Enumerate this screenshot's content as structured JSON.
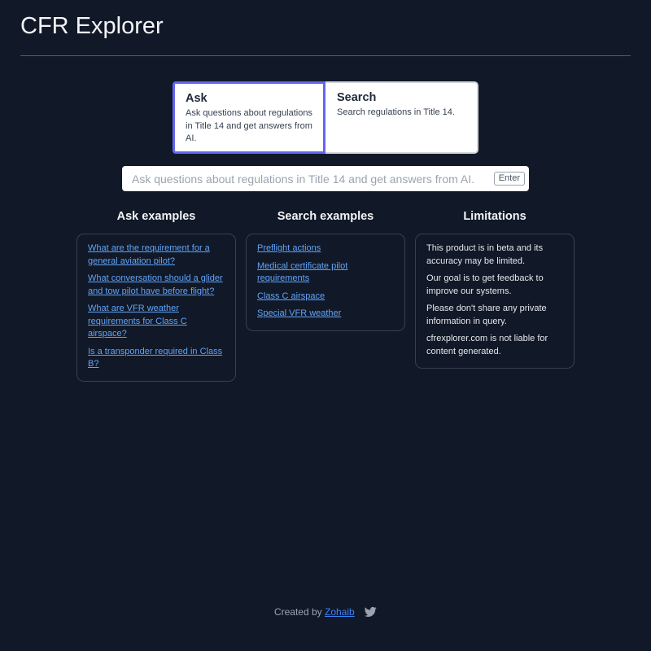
{
  "header": {
    "title": "CFR Explorer"
  },
  "modes": [
    {
      "title": "Ask",
      "description": "Ask questions about regulations in Title 14 and get answers from AI.",
      "active": true
    },
    {
      "title": "Search",
      "description": "Search regulations in Title 14.",
      "active": false
    }
  ],
  "query": {
    "value": "",
    "placeholder": "Ask questions about regulations in Title 14 and get answers from AI.",
    "enter_label": "Enter"
  },
  "ask_examples": {
    "title": "Ask examples",
    "items": [
      "What are the requirement for a general aviation pilot?",
      "What conversation should a glider and tow pilot have before flight?",
      "What are VFR weather requirements for Class C airspace?",
      "Is a transponder required in Class B?"
    ]
  },
  "search_examples": {
    "title": "Search examples",
    "items": [
      "Preflight actions",
      "Medical certificate pilot requirements",
      "Class C airspace",
      "Special VFR weather"
    ]
  },
  "limitations": {
    "title": "Limitations",
    "items": [
      "This product is in beta and its accuracy may be limited.",
      "Our goal is to get feedback to improve our systems.",
      "Please don't share any private information in query.",
      "cfrexplorer.com is not liable for content generated."
    ]
  },
  "footer": {
    "created_by": "Created by",
    "author": "Zohaib",
    "social_icon": "twitter-icon"
  },
  "colors": {
    "background": "#111827",
    "accent": "#6366f1",
    "link": "#60a5fa",
    "rule": "#4f52b8"
  }
}
